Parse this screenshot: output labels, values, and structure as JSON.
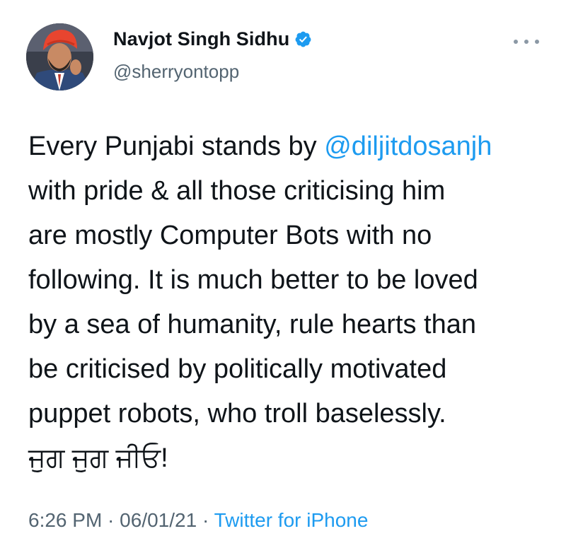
{
  "author": {
    "display_name": "Navjot Singh Sidhu",
    "handle": "@sherryontopp",
    "verified": true,
    "avatar_icon": "profile-photo",
    "verified_icon": "verified-badge-icon"
  },
  "more_icon": "more-horizontal-icon",
  "tweet": {
    "line1_prefix": "Every Punjabi stands by ",
    "mention": "@diljitdosanjh",
    "line2": "with pride & all those criticising him",
    "line3": "are mostly Computer Bots with no",
    "line4": "following. It is much better to be loved",
    "line5": "by a sea of humanity, rule hearts than",
    "line6": "be criticised by politically motivated",
    "line7": "puppet robots, who troll baselessly.",
    "line8": "ਜੁਗ ਜੁਗ ਜੀਓ!"
  },
  "meta": {
    "time": "6:26 PM",
    "separator": " · ",
    "date": "06/01/21",
    "source": "Twitter for iPhone"
  },
  "colors": {
    "link": "#1d9bf0",
    "secondary_text": "#536471",
    "primary_text": "#0f1419",
    "verified": "#1d9bf0",
    "turban": "#e8452f"
  }
}
